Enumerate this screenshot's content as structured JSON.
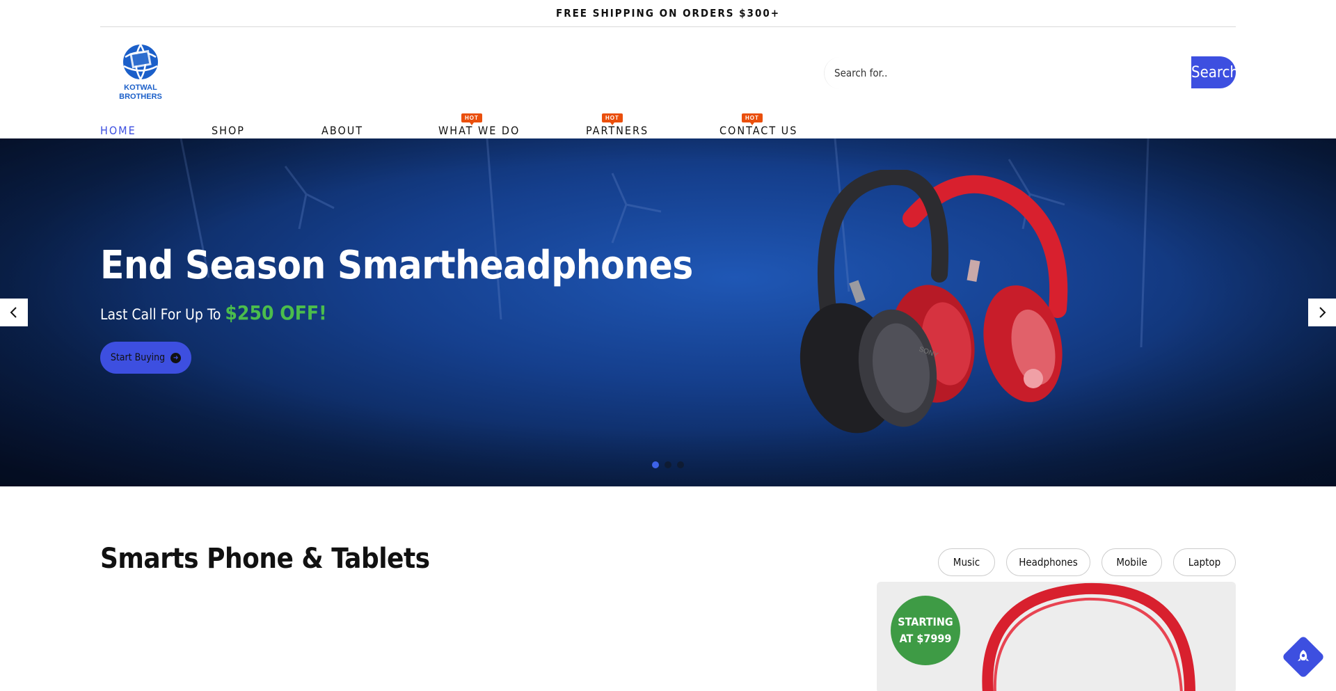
{
  "topbar": {
    "text": "FREE SHIPPING ON ORDERS $300+"
  },
  "brand": {
    "line1": "KOTWAL",
    "line2": "BROTHERS"
  },
  "search": {
    "placeholder": "Search for..",
    "button": "Search"
  },
  "nav": {
    "items": [
      {
        "label": "HOME",
        "active": true
      },
      {
        "label": "SHOP"
      },
      {
        "label": "ABOUT"
      },
      {
        "label": "WHAT WE DO",
        "badge": "HOT"
      },
      {
        "label": "PARTNERS",
        "badge": "HOT"
      },
      {
        "label": "CONTACT US",
        "badge": "HOT"
      }
    ]
  },
  "hero": {
    "title": "End Season Smartheadphones",
    "subtitle_prefix": "Last Call For Up To",
    "subtitle_promo": "$250 OFF!",
    "cta": "Start Buying",
    "slides": 3,
    "active_slide": 1
  },
  "section": {
    "title": "Smarts Phone & Tablets",
    "filters": [
      "Music",
      "Headphones",
      "Mobile",
      "Laptop"
    ],
    "promo_badge": {
      "line1": "STARTING",
      "line2": "AT $7999"
    }
  },
  "colors": {
    "accent": "#3d4fe0",
    "promo_green": "#4bbd4c",
    "hot": "#ea4f0c",
    "badge_green": "#3e9b45"
  }
}
